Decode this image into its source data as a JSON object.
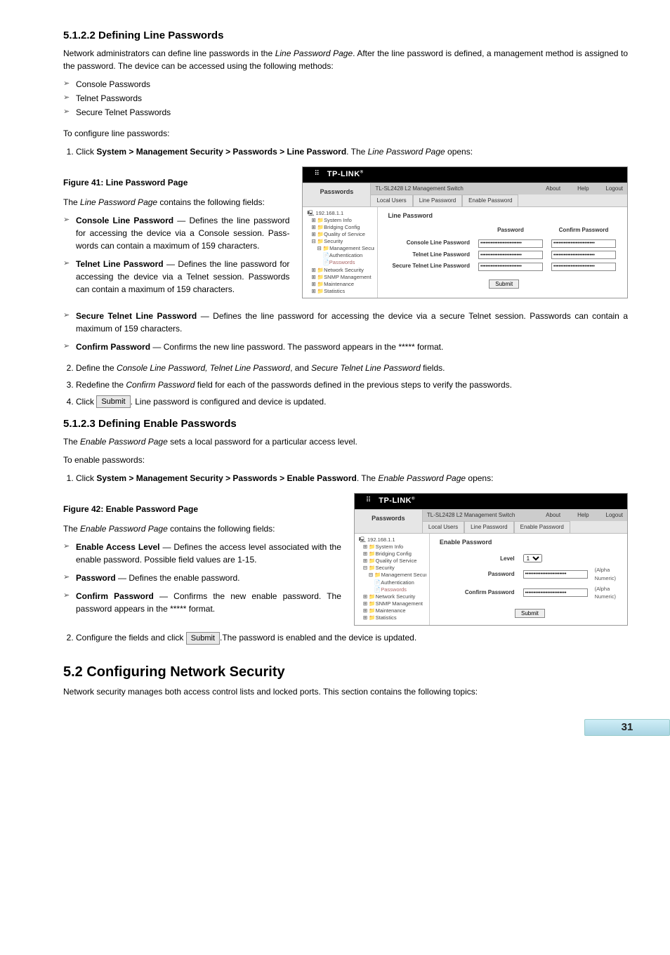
{
  "h_51_2_2": "5.1.2.2  Defining Line Passwords",
  "p_line_intro": "Network administrators can define line passwords in the Line Password Page. After the line password is defined, a management method is assigned to the password. The device can be accessed using the following methods:",
  "line_methods": [
    "Console Passwords",
    "Telnet Passwords",
    "Secure Telnet Passwords"
  ],
  "p_to_cfg_line": "To configure line passwords:",
  "ol_line_1_pre": "Click ",
  "ol_line_1_path": "System > Management Security > Passwords > Line Password",
  "ol_line_1_post": ". The Line Password Page opens:",
  "fig41_caption": "Figure 41: Line Password Page",
  "p_line_fields_intro": "The Line Password Page contains the following fields:",
  "f_console_b": "Console Line Password",
  "f_console_t": " — Defines the line password for accessing the device via a Console session. Pass­words can contain a maximum of 159 characters.",
  "f_telnet_b": "Telnet Line Password",
  "f_telnet_t": " — Defines the line password for accessing the device via a Telnet session. Pass­words can contain a maximum of 159 characters.",
  "f_stelnet_b": "Secure Telnet Line Password",
  "f_stelnet_t": " — Defines the line password for accessing the device via a secure Telnet session. Passwords can contain a maximum of 159 characters.",
  "f_confirm_b": "Confirm Password",
  "f_confirm_t": " — Confirms the new line password. The password appears in the ***** format.",
  "ol_line_2": "Define the Console Line Password, Telnet Line Password, and Secure Telnet Line Password fields.",
  "ol_line_3": "Redefine the Confirm Password field for each of the passwords defined in the previous steps to verify the passwords.",
  "ol_line_4_pre": "Click ",
  "ol_line_4_post": ". Line password is configured and device is updated.",
  "btn_submit": "Submit",
  "h_51_2_3": "5.1.2.3  Defining Enable Passwords",
  "p_enable_intro": "The Enable Password Page sets a local password for a particular access level.",
  "p_to_enable": "To enable passwords:",
  "ol_en_1_pre": "Click ",
  "ol_en_1_path": "System > Management Security > Passwords > Enable Password",
  "ol_en_1_post": ". The Enable Password Page opens:",
  "fig42_caption": "Figure 42: Enable Password Page",
  "p_enable_fields_intro": "The Enable Password Page contains the following fields:",
  "f_en_level_b": "Enable Access Level",
  "f_en_level_t": " — Defines the access level associated with the enable password. Possible field val­ues are 1-15.",
  "f_en_pw_b": "Password",
  "f_en_pw_t": " — Defines the enable password.",
  "f_en_conf_b": "Confirm Password",
  "f_en_conf_t": " — Confirms the new enable password. The password appears in the ***** format.",
  "ol_en_2_pre": "Configure the fields and click ",
  "ol_en_2_post": ".The password is enabled and the device is updated.",
  "h_52": "5.2  Configuring Network Security",
  "p_52": "Network security manages both access control lists and locked ports. This section contains the following topics:",
  "page_number": "31",
  "shot": {
    "logo": "TP-LINK",
    "left_label": "Passwords",
    "title": "TL-SL2428 L2 Management Switch",
    "link_about": "About",
    "link_help": "Help",
    "link_logout": "Logout",
    "tab_local": "Local Users",
    "tab_line": "Line Password",
    "tab_enable": "Enable Password",
    "tree": {
      "root": "192.168.1.1",
      "sysinfo": "System Info",
      "bridging": "Bridging Config",
      "qos": "Quality of Service",
      "security": "Security",
      "mgmt_sec": "Management Security",
      "auth": "Authentication",
      "passwords": "Passwords",
      "net_sec": "Network Security",
      "snmp": "SNMP Management",
      "maint": "Maintenance",
      "stats": "Statistics"
    },
    "line": {
      "panel": "Line Password",
      "col_pw": "Password",
      "col_conf": "Confirm Password",
      "row_console": "Console Line Password",
      "row_telnet": "Telnet Line Password",
      "row_stelnet": "Secure Telnet Line Password",
      "submit": "Submit"
    },
    "enable": {
      "panel": "Enable Password",
      "row_level": "Level",
      "level_val": "1",
      "row_pw": "Password",
      "row_conf": "Confirm Password",
      "note": "(Alpha Numeric)",
      "submit": "Submit"
    }
  }
}
